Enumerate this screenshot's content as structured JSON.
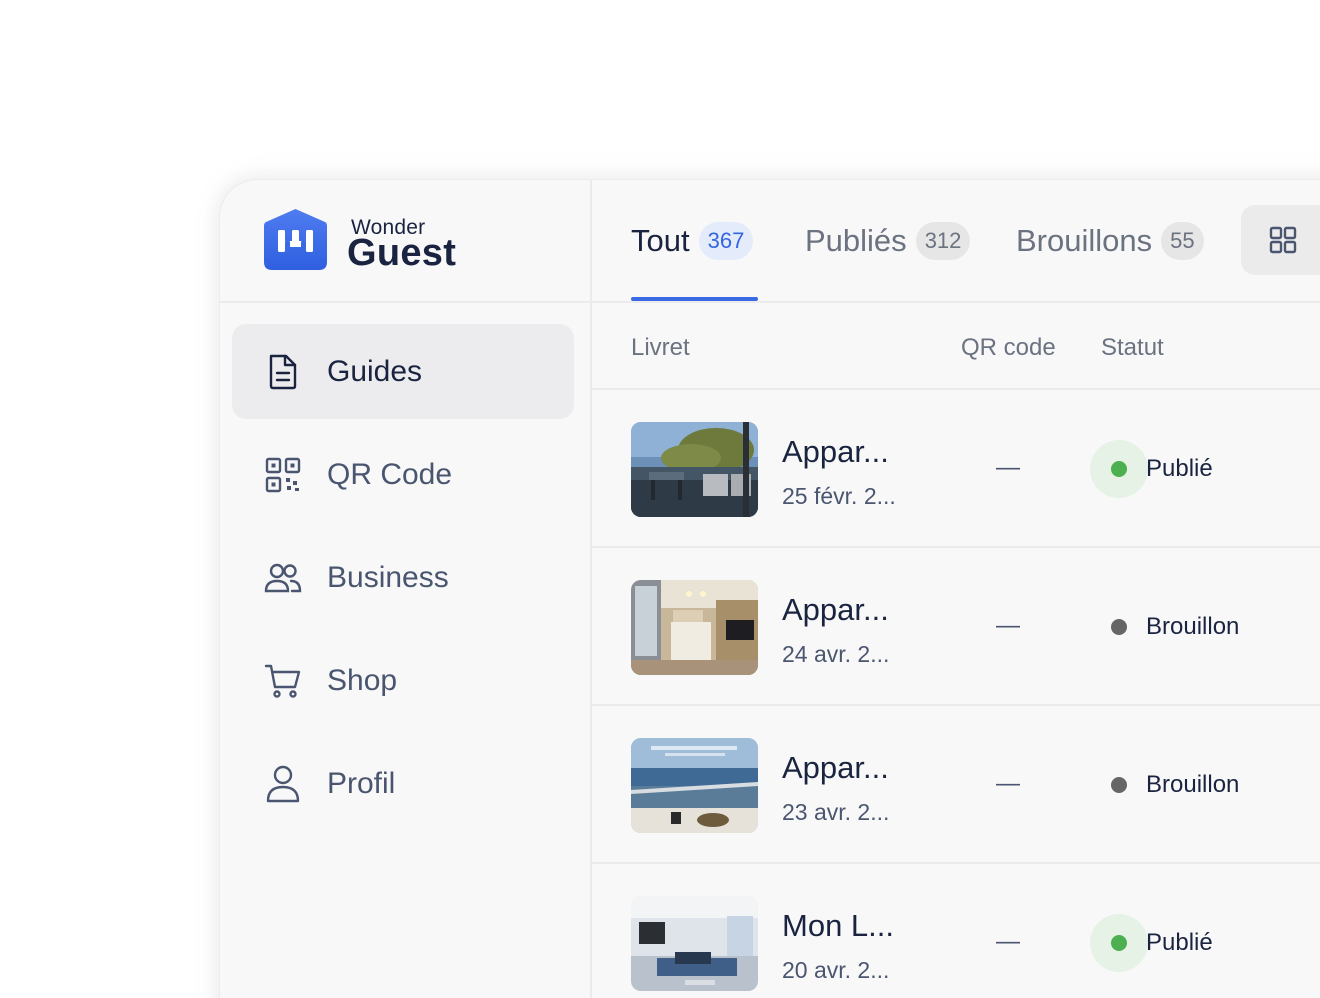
{
  "brand": {
    "wonder": "Wonder",
    "guest": "Guest",
    "accent_color": "#3a6ae3"
  },
  "sidebar": {
    "items": [
      {
        "label": "Guides",
        "icon": "document-icon",
        "active": true
      },
      {
        "label": "QR Code",
        "icon": "qr-code-icon",
        "active": false
      },
      {
        "label": "Business",
        "icon": "users-icon",
        "active": false
      },
      {
        "label": "Shop",
        "icon": "cart-icon",
        "active": false
      },
      {
        "label": "Profil",
        "icon": "user-icon",
        "active": false
      }
    ]
  },
  "tabs": [
    {
      "label": "Tout",
      "count": "367",
      "active": true
    },
    {
      "label": "Publiés",
      "count": "312",
      "active": false
    },
    {
      "label": "Brouillons",
      "count": "55",
      "active": false
    }
  ],
  "view_toggle_icon": "grid-icon",
  "table": {
    "columns": [
      "Livret",
      "QR code",
      "Statut"
    ],
    "rows": [
      {
        "title": "Appar...",
        "date": "25 févr. 2...",
        "qr": "—",
        "status": "Publié",
        "status_color": "#4caf50",
        "thumb": "patio"
      },
      {
        "title": "Appar...",
        "date": "24 avr. 2...",
        "qr": "—",
        "status": "Brouillon",
        "status_color": "#666666",
        "thumb": "kitchen"
      },
      {
        "title": "Appar...",
        "date": "23 avr. 2...",
        "qr": "—",
        "status": "Brouillon",
        "status_color": "#666666",
        "thumb": "balcony"
      },
      {
        "title": "Mon L...",
        "date": "20 avr. 2...",
        "qr": "—",
        "status": "Publié",
        "status_color": "#4caf50",
        "thumb": "living"
      }
    ]
  }
}
